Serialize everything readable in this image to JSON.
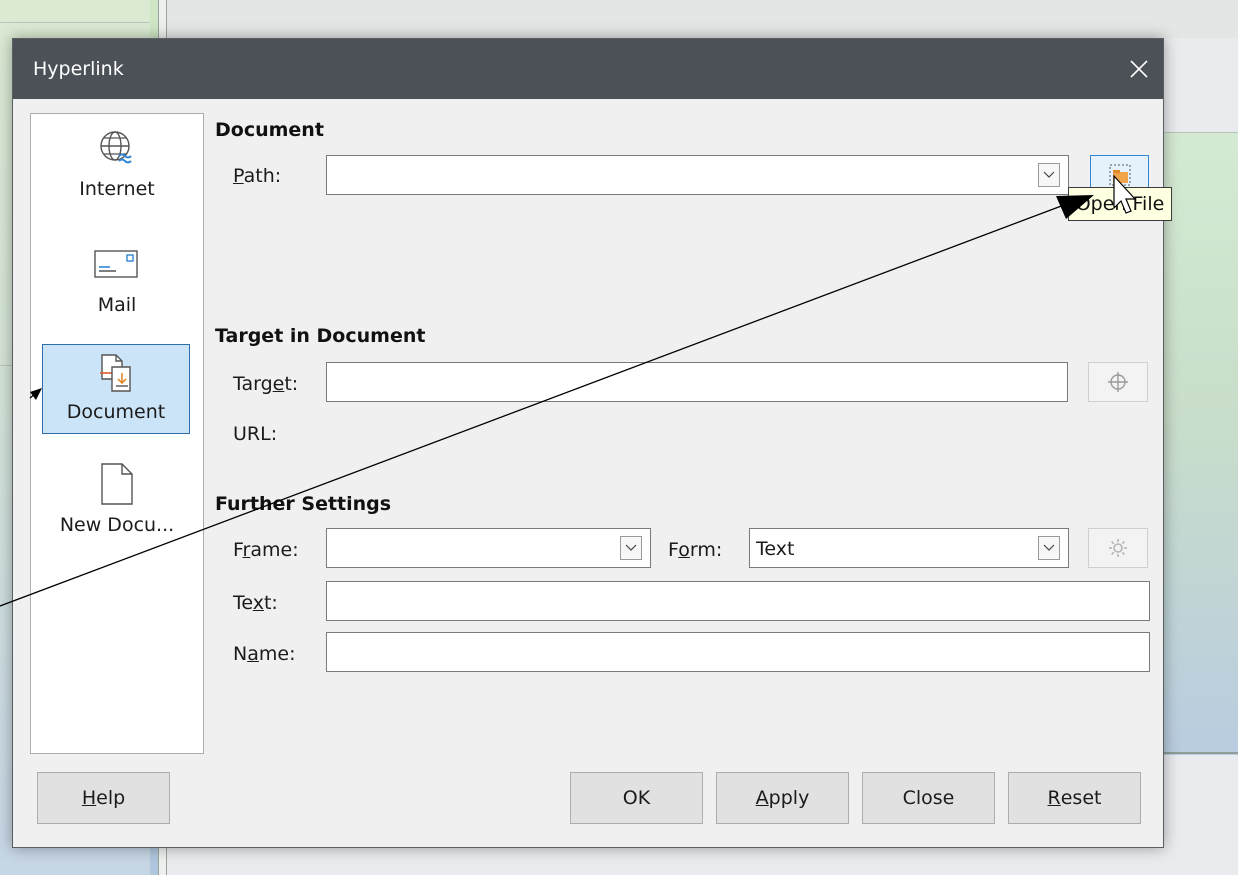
{
  "window": {
    "title": "Hyperlink"
  },
  "categories": [
    {
      "label": "Internet",
      "icon": "globe-icon",
      "selected": false
    },
    {
      "label": "Mail",
      "icon": "envelope-icon",
      "selected": false
    },
    {
      "label": "Document",
      "icon": "document-link-icon",
      "selected": true
    },
    {
      "label": "New Docu...",
      "icon": "new-document-icon",
      "selected": false
    }
  ],
  "document_section": {
    "title": "Document",
    "path_label": {
      "mnemonic": "P",
      "rest": "ath:"
    },
    "path_value": "",
    "open_file_tooltip": "Open File"
  },
  "target_section": {
    "title": "Target in Document",
    "target_label": {
      "pre": "Targ",
      "mnemonic": "e",
      "post": "t:"
    },
    "target_value": "",
    "url_label": "URL:"
  },
  "further_section": {
    "title": "Further Settings",
    "frame_label": {
      "pre": "F",
      "mnemonic": "r",
      "post": "ame:"
    },
    "frame_value": "",
    "form_label": {
      "pre": "F",
      "mnemonic": "o",
      "post": "rm:"
    },
    "form_value": "Text",
    "text_label": {
      "pre": "Te",
      "mnemonic": "x",
      "post": "t:"
    },
    "text_value": "",
    "name_label": {
      "pre": "N",
      "mnemonic": "a",
      "post": "me:"
    },
    "name_value": ""
  },
  "buttons": {
    "help": {
      "mnemonic": "H",
      "rest": "elp"
    },
    "ok": "OK",
    "apply": {
      "mnemonic": "A",
      "rest": "pply"
    },
    "close": "Close",
    "reset": {
      "mnemonic": "R",
      "rest": "eset"
    }
  },
  "colors": {
    "titlebar": "#4b5157",
    "selection": "#cce4f7",
    "selection_border": "#2f6ea8",
    "tooltip_bg": "#ffffe1"
  }
}
